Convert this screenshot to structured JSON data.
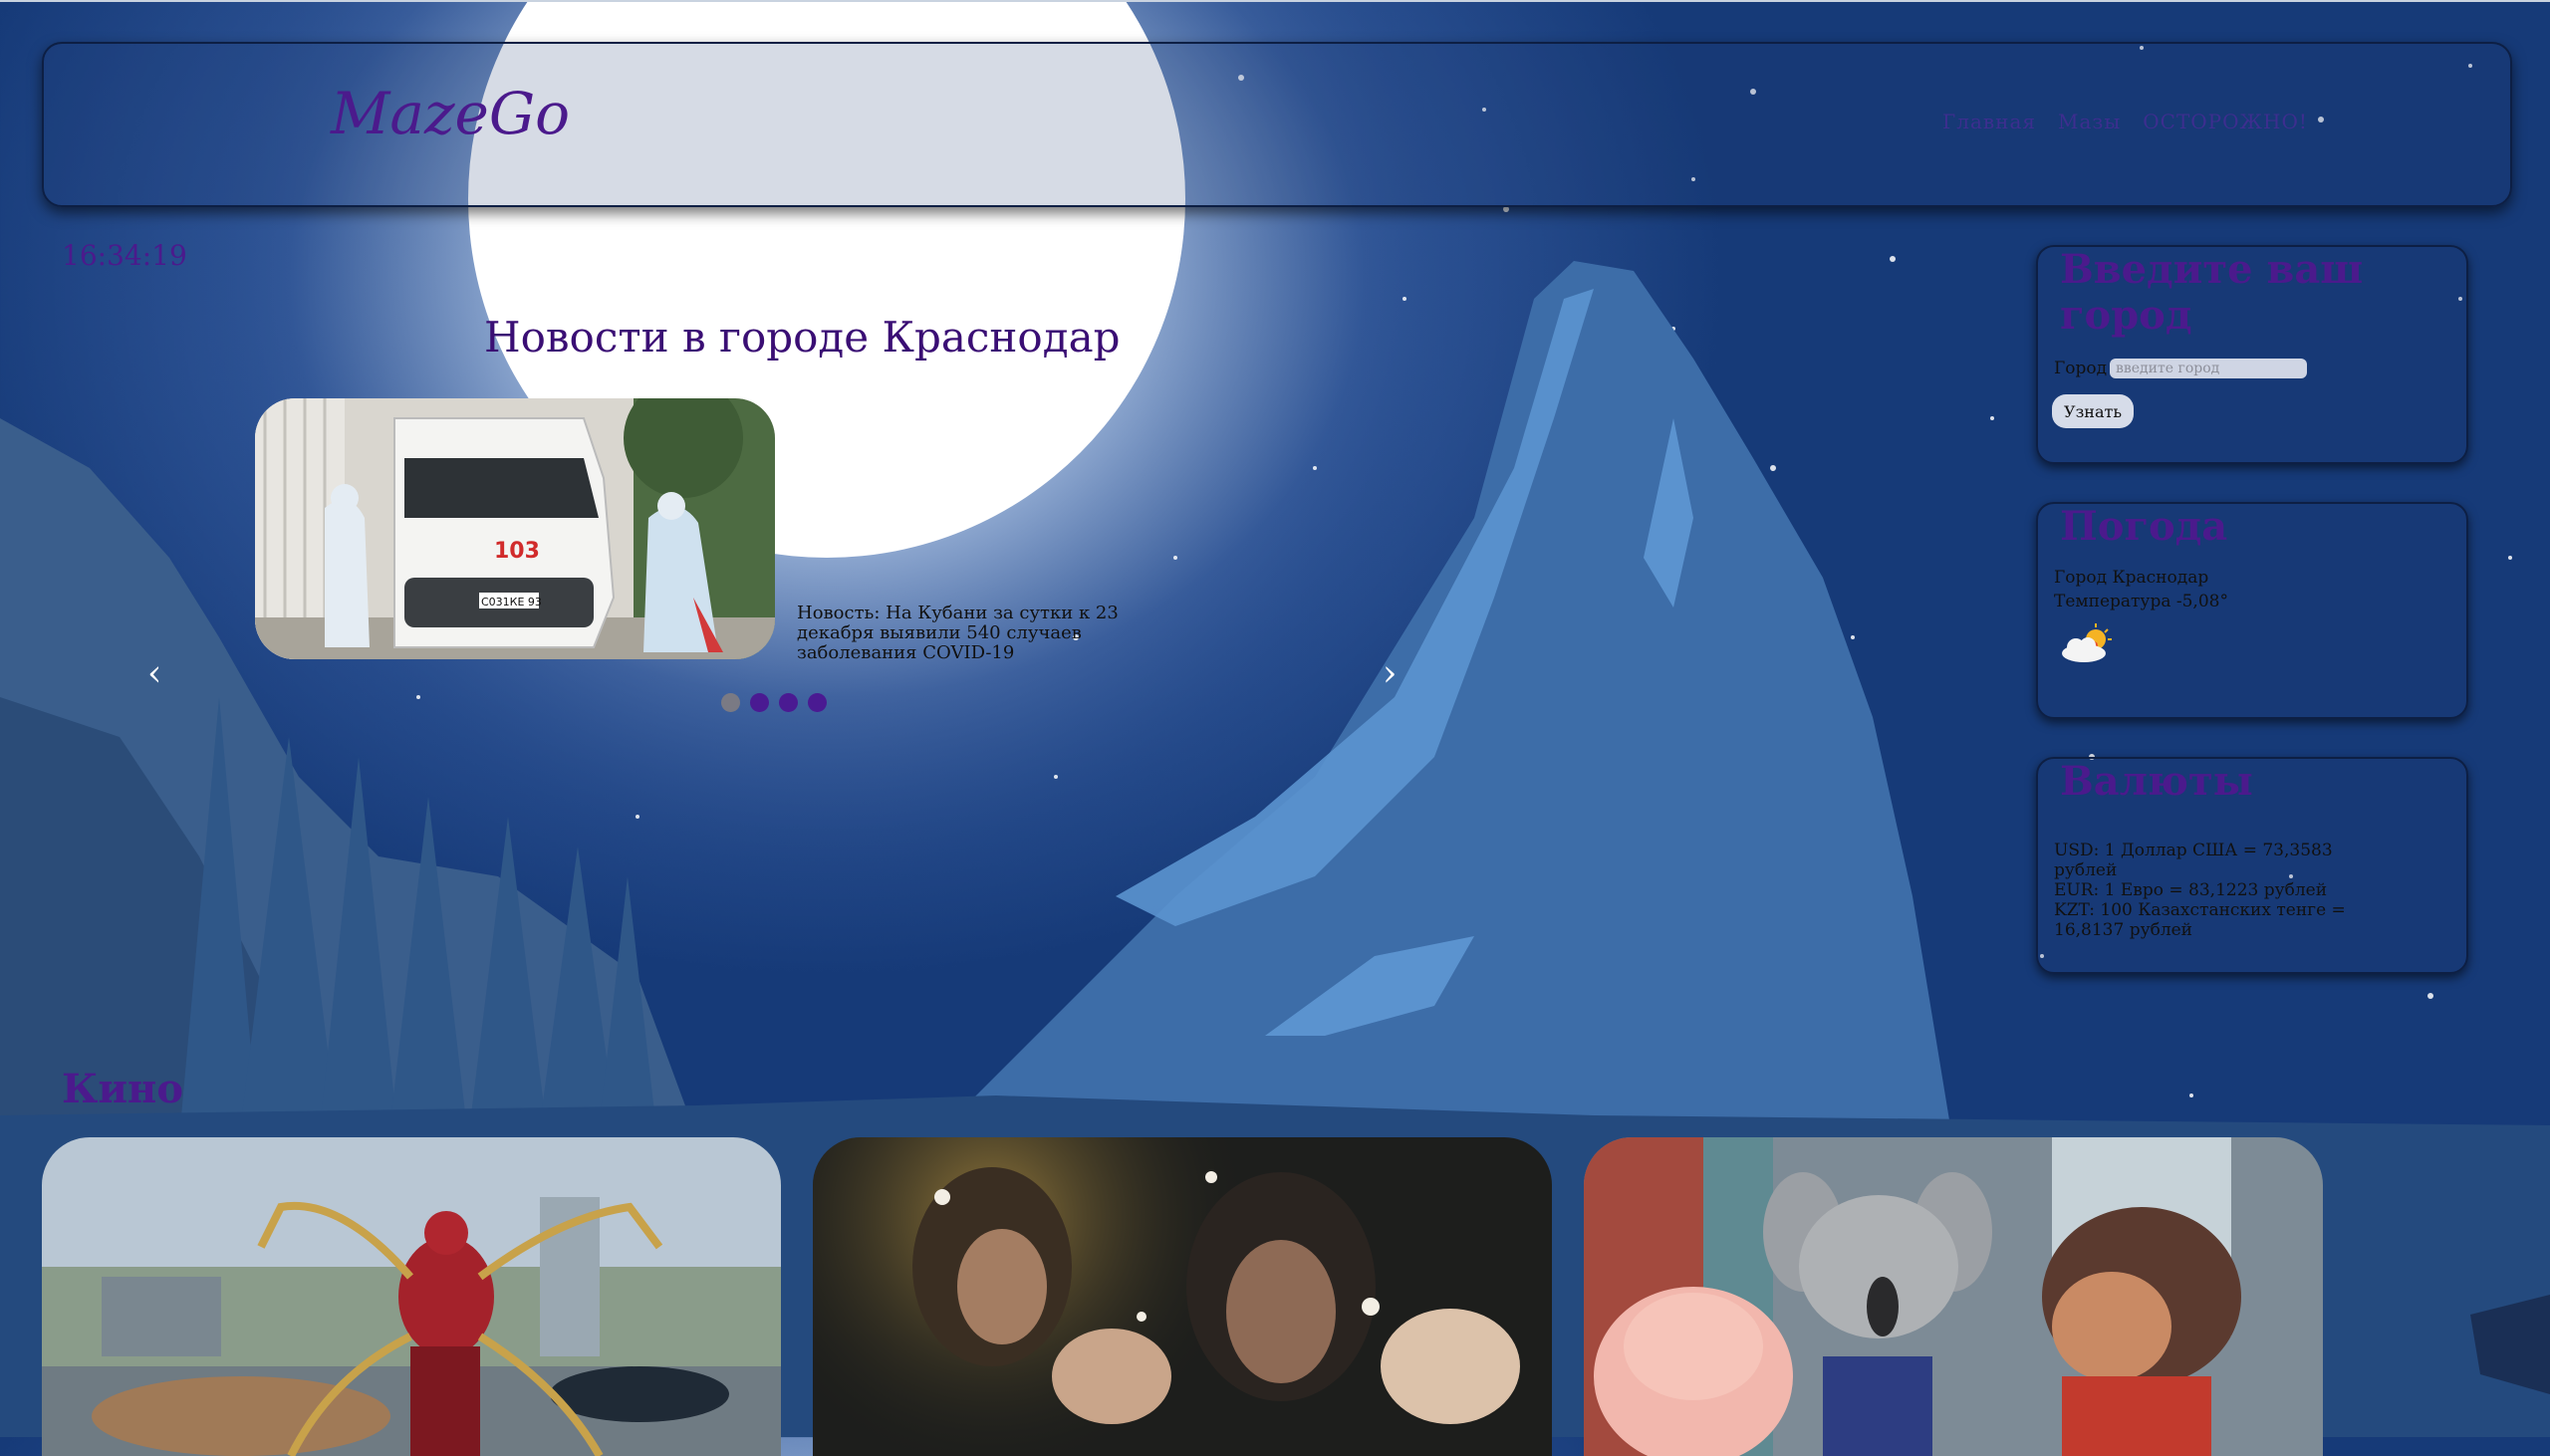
{
  "header": {
    "logo": "MazeGo",
    "nav": [
      "Главная",
      "Мазы",
      "ОСТОРОЖНО!"
    ]
  },
  "clock": "16:34:19",
  "news": {
    "title": "Новости в городе Краснодар",
    "image_text": "103",
    "plate": "С031КЕ 93",
    "caption": "Новость: На Кубани за сутки к 23 декабря выявили 540 случаев заболевания COVID-19",
    "prev": "‹",
    "next": "›",
    "slides": 4,
    "active_slide": 1
  },
  "city_card": {
    "title": "Введите ваш город",
    "label": "Город",
    "placeholder": "введите город",
    "button": "Узнать"
  },
  "weather_card": {
    "title": "Погода",
    "city": "Город Краснодар",
    "temp": "Температура -5,08°",
    "icon": "partly-cloudy-icon"
  },
  "currency_card": {
    "title": "Валюты",
    "lines": [
      "USD: 1 Доллар США = 73,3583 рублей",
      "EUR: 1 Евро = 83,1223 рублей",
      "KZT: 100 Казахстанских тенге = 16,8137 рублей"
    ]
  },
  "kino": {
    "title": "Кино",
    "films": [
      "film-1",
      "film-2",
      "film-3"
    ]
  },
  "colors": {
    "accent": "#4b1a8c",
    "sky": "#163a78",
    "mountain": "#3a6aa8"
  }
}
